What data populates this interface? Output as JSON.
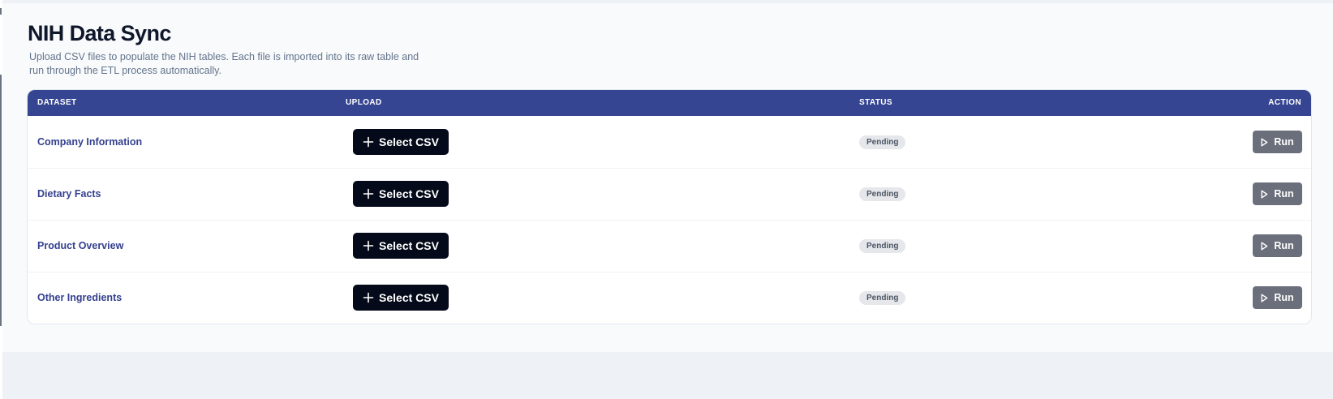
{
  "page": {
    "title": "NIH Data Sync",
    "description": "Upload CSV files to populate the NIH tables. Each file is imported into its raw table and run through the ETL process automatically."
  },
  "table": {
    "headers": {
      "dataset": "DATASET",
      "upload": "UPLOAD",
      "status": "STATUS",
      "action": "ACTION"
    },
    "rows": [
      {
        "dataset": "Company Information",
        "upload_label": "Select CSV",
        "status": "Pending",
        "action_label": "Run"
      },
      {
        "dataset": "Dietary Facts",
        "upload_label": "Select CSV",
        "status": "Pending",
        "action_label": "Run"
      },
      {
        "dataset": "Product Overview",
        "upload_label": "Select CSV",
        "status": "Pending",
        "action_label": "Run"
      },
      {
        "dataset": "Other Ingredients",
        "upload_label": "Select CSV",
        "status": "Pending",
        "action_label": "Run"
      }
    ]
  },
  "icons": {
    "upload": "plus-icon",
    "action": "play-icon"
  },
  "colors": {
    "header_bg": "#364591",
    "dataset_link": "#34408f",
    "upload_button": "#050a1a",
    "run_button": "#6b6f7b",
    "status_pill_bg": "#e5e7eb"
  }
}
